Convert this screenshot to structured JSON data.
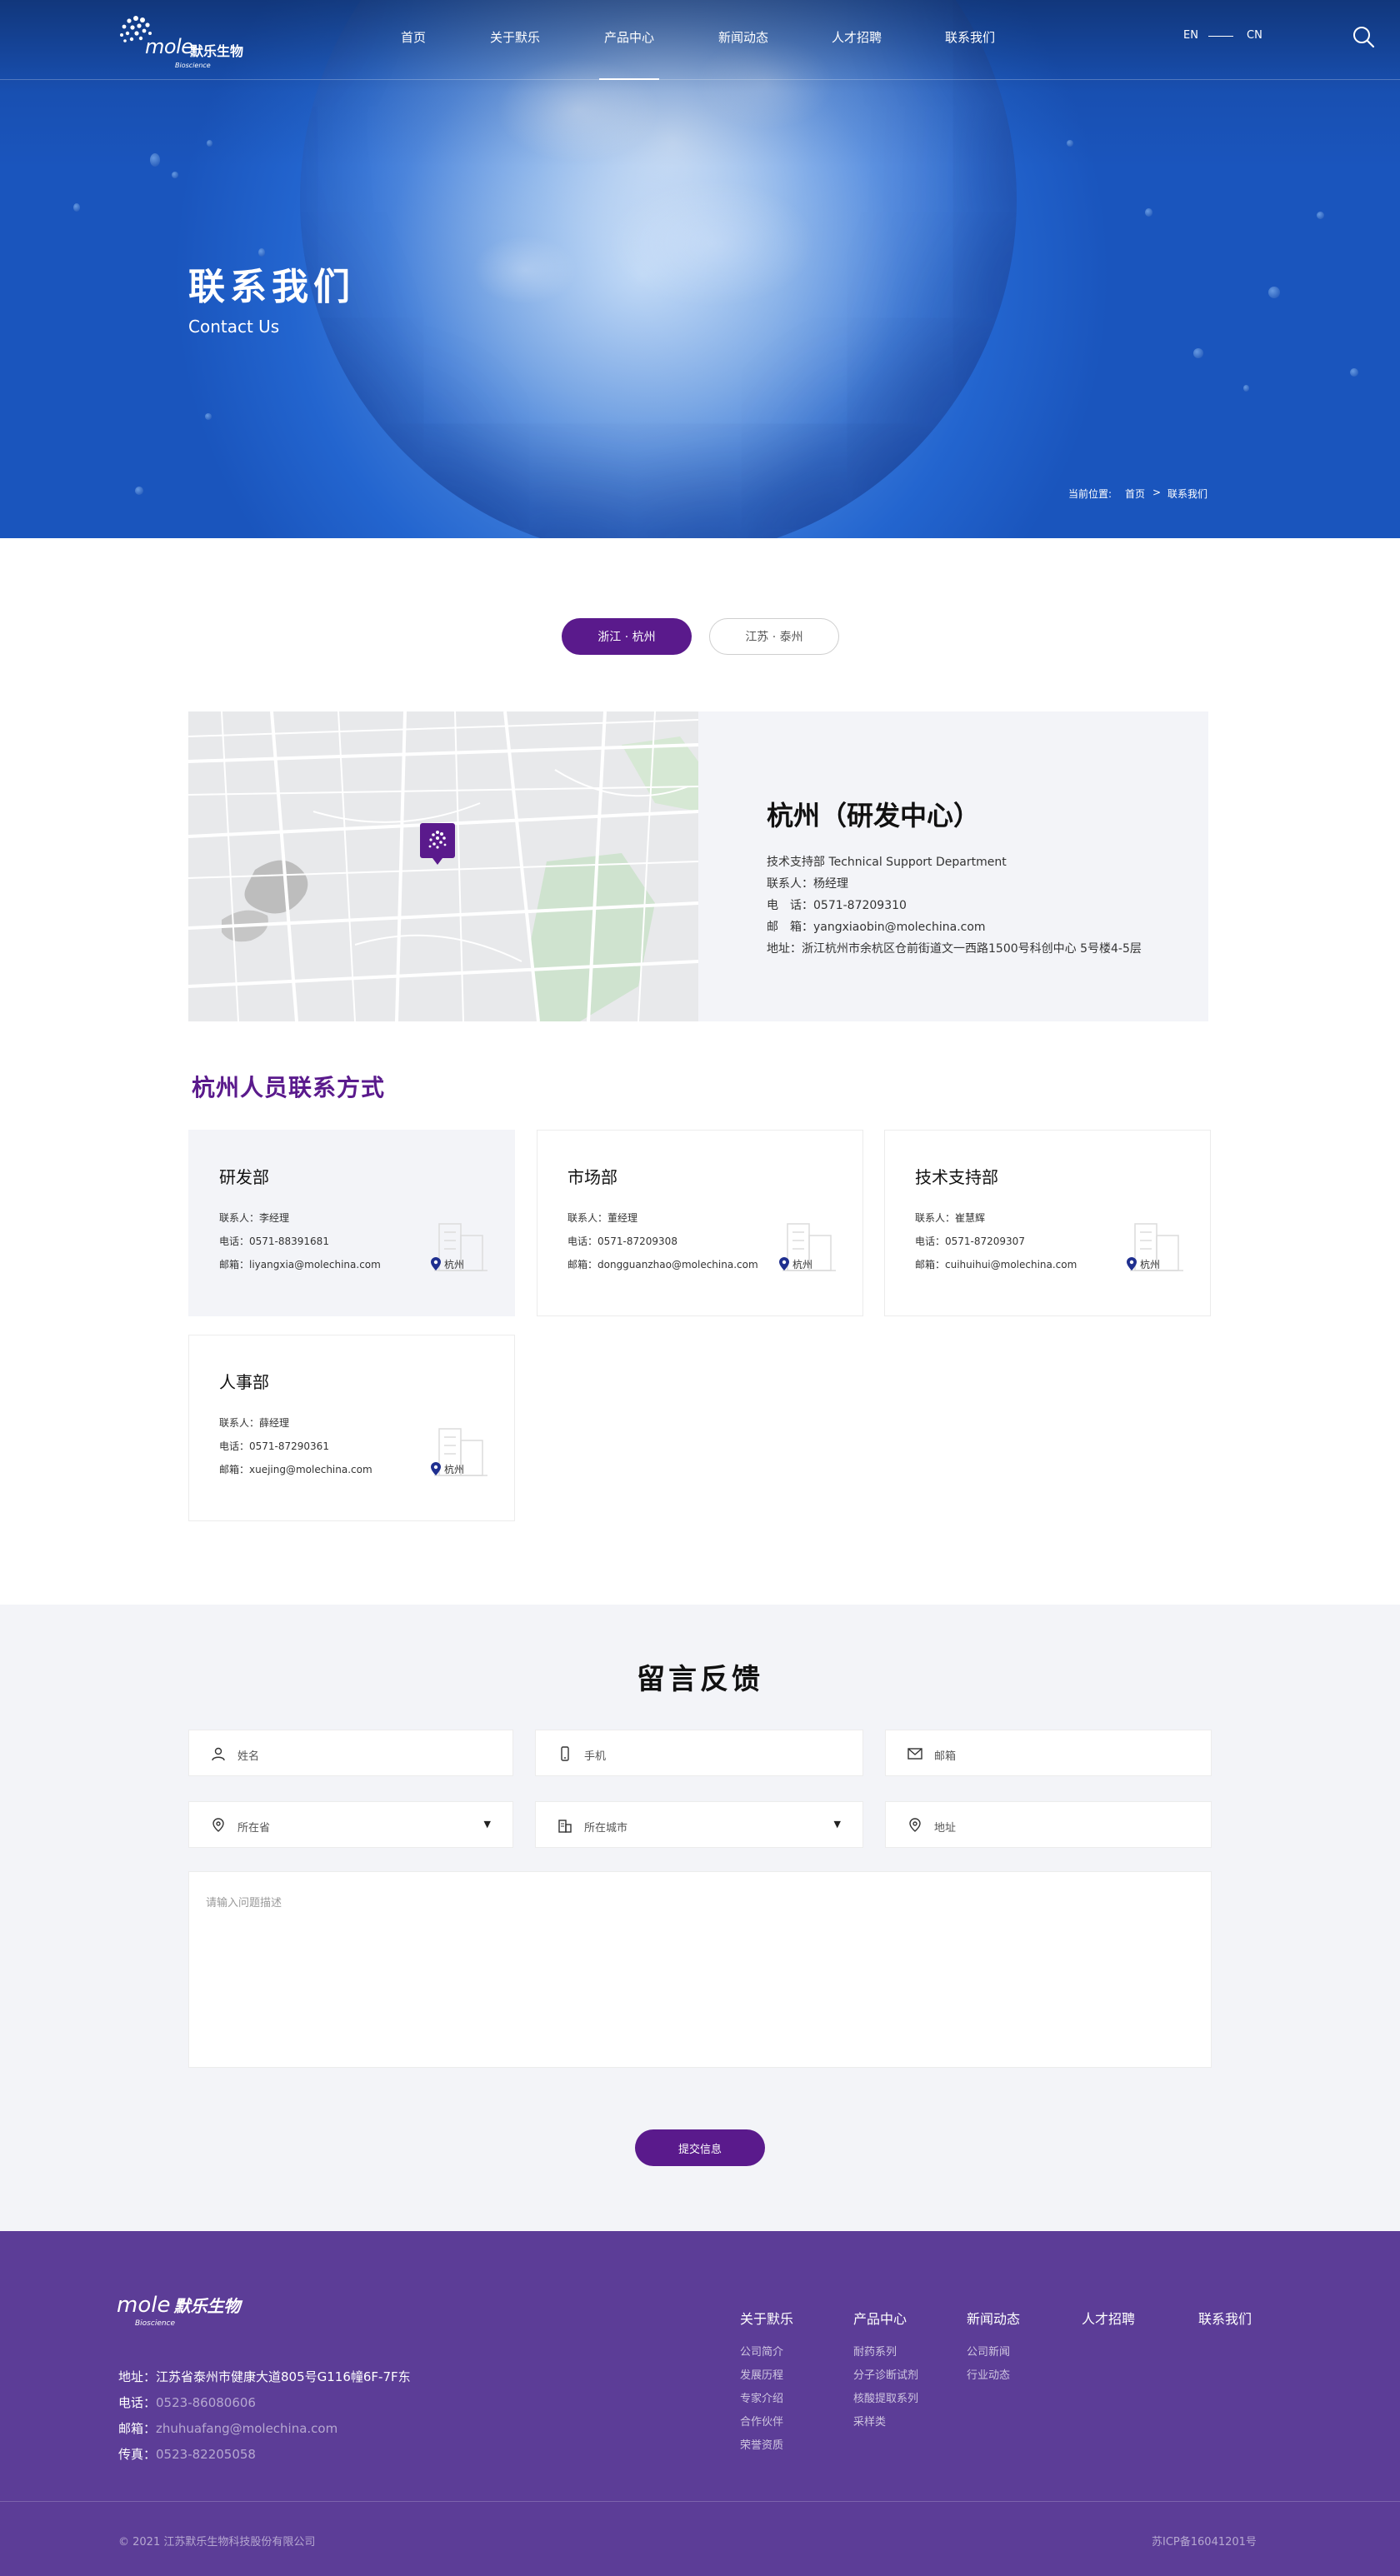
{
  "nav": {
    "logo_text": "mole",
    "logo_cn": "默乐生物",
    "logo_sub": "Bioscience",
    "items": [
      "首页",
      "关于默乐",
      "产品中心",
      "新闻动态",
      "人才招聘",
      "联系我们"
    ],
    "lang_en": "EN",
    "lang_cn": "CN"
  },
  "hero": {
    "title": "联系我们",
    "subtitle": "Contact Us",
    "breadcrumb_label": "当前位置:",
    "breadcrumb_home": "首页",
    "breadcrumb_sep": ">",
    "breadcrumb_current": "联系我们"
  },
  "tabs": [
    "浙江 · 杭州",
    "江苏 · 泰州"
  ],
  "location": {
    "title": "杭州（研发中心）",
    "lines": [
      "技术支持部 Technical Support Department",
      "联系人：杨经理",
      "电　话：0571-87209310",
      "邮　箱：yangxiaobin@molechina.com",
      "地址：浙江杭州市余杭区仓前街道文一西路1500号科创中心 5号楼4-5层"
    ]
  },
  "staff": {
    "title": "杭州人员联系方式",
    "depts": [
      {
        "name": "研发部",
        "contact": "联系人：李经理",
        "phone": "电话：0571-88391681",
        "email": "邮箱：liyangxia@molechina.com",
        "city": "杭州"
      },
      {
        "name": "市场部",
        "contact": "联系人：董经理",
        "phone": "电话：0571-87209308",
        "email": "邮箱：dongguanzhao@molechina.com",
        "city": "杭州"
      },
      {
        "name": "技术支持部",
        "contact": "联系人：崔慧辉",
        "phone": "电话：0571-87209307",
        "email": "邮箱：cuihuihui@molechina.com",
        "city": "杭州"
      },
      {
        "name": "人事部",
        "contact": "联系人：薛经理",
        "phone": "电话：0571-87290361",
        "email": "邮箱：xuejing@molechina.com",
        "city": "杭州"
      }
    ]
  },
  "feedback": {
    "title": "留言反馈",
    "name_ph": "姓名",
    "phone_ph": "手机",
    "email_ph": "邮箱",
    "province_ph": "所在省",
    "city_ph": "所在城市",
    "address_ph": "地址",
    "message_ph": "请输入问题描述",
    "submit": "提交信息"
  },
  "footer": {
    "logo_text": "mole",
    "logo_cn": "默乐生物",
    "logo_sub": "Bioscience",
    "address": "地址：江苏省泰州市健康大道805号G116幢6F-7F东",
    "phone_label": "电话：",
    "phone": "0523-86080606",
    "email_label": "邮箱：",
    "email": "zhuhuafang@molechina.com",
    "fax_label": "传真：",
    "fax": "0523-82205058",
    "columns": [
      {
        "title": "关于默乐",
        "links": [
          "公司简介",
          "发展历程",
          "专家介绍",
          "合作伙伴",
          "荣誉资质"
        ]
      },
      {
        "title": "产品中心",
        "links": [
          "耐药系列",
          "分子诊断试剂",
          "核酸提取系列",
          "采样类"
        ]
      },
      {
        "title": "新闻动态",
        "links": [
          "公司新闻",
          "行业动态"
        ]
      },
      {
        "title": "人才招聘",
        "links": []
      },
      {
        "title": "联系我们",
        "links": []
      }
    ],
    "copyright": "© 2021 江苏默乐生物科技股份有限公司",
    "icp": "苏ICP备16041201号"
  }
}
